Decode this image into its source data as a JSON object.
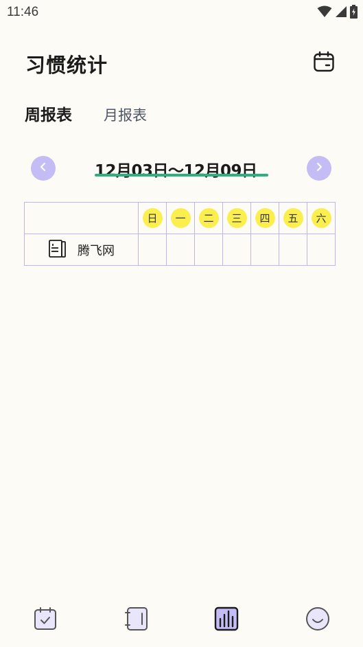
{
  "status_bar": {
    "time": "11:46",
    "icons": [
      "wifi-icon",
      "signal-icon",
      "battery-icon"
    ]
  },
  "header": {
    "title": "习惯统计",
    "calendar_icon": "calendar-icon"
  },
  "tabs": {
    "weekly": "周报表",
    "monthly": "月报表",
    "active": "weekly"
  },
  "date_nav": {
    "range": "12月03日～12月09日",
    "prev_icon": "chevron-left-icon",
    "next_icon": "chevron-right-icon"
  },
  "table": {
    "days": [
      "日",
      "一",
      "二",
      "三",
      "四",
      "五",
      "六"
    ],
    "habits": [
      {
        "name": "腾飞网",
        "icon": "notebook-icon"
      }
    ]
  },
  "bottom_nav": {
    "items": [
      {
        "icon": "checkin-icon"
      },
      {
        "icon": "notebook-icon"
      },
      {
        "icon": "stats-icon",
        "active": true
      },
      {
        "icon": "smile-icon"
      }
    ]
  },
  "colors": {
    "background": "#fcfbf5",
    "accent_purple": "#c4bcf5",
    "underline_green": "#2fae82",
    "day_yellow": "#fbef4f",
    "table_border": "#bfb5ee"
  }
}
